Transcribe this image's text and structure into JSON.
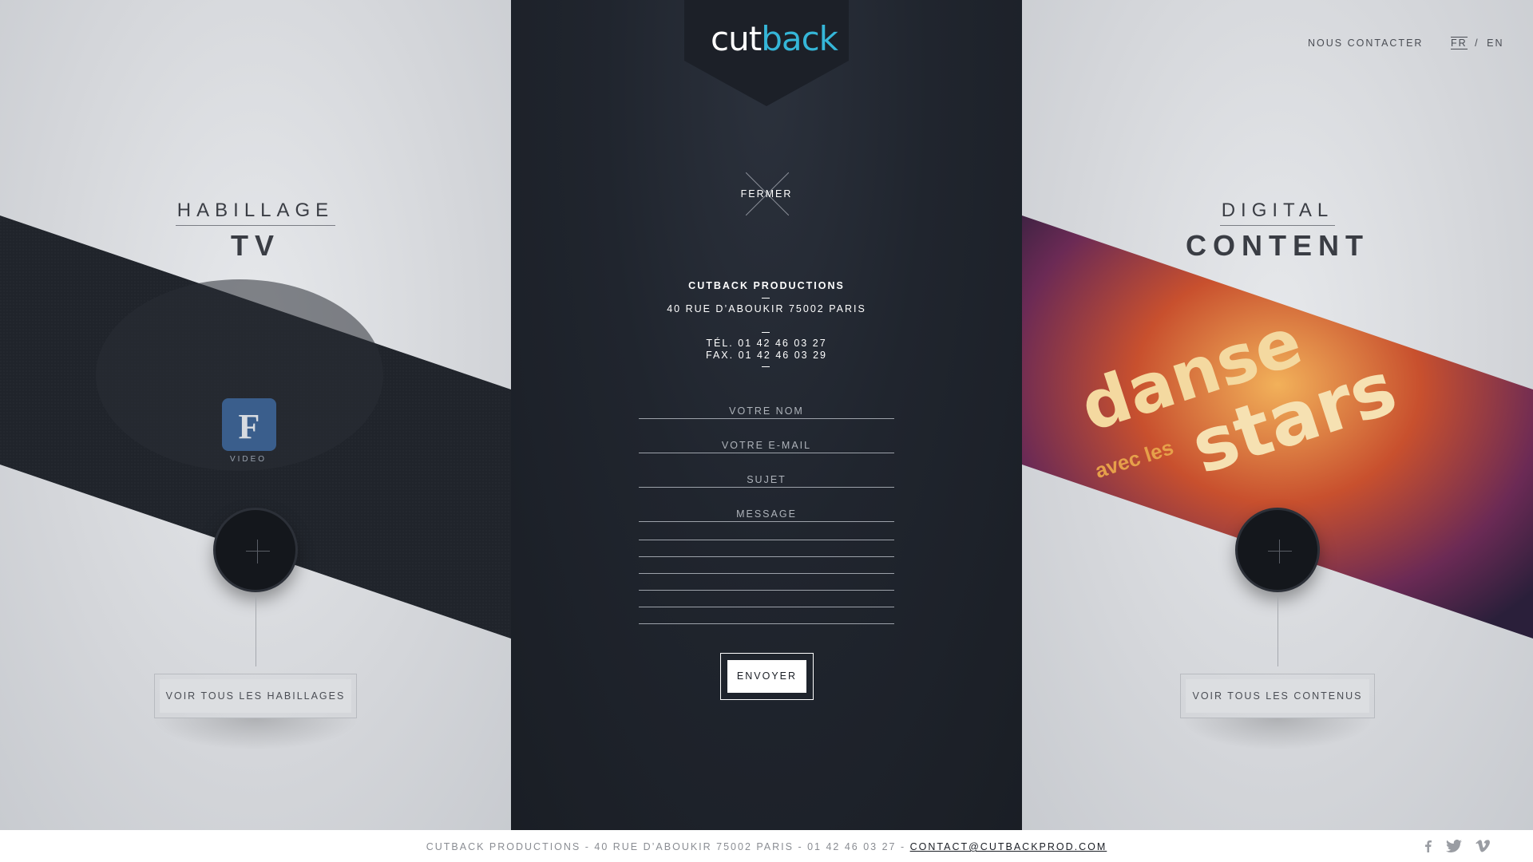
{
  "brand": {
    "logo_part1": "cut",
    "logo_part2": "back",
    "accent": "#35b6d8",
    "dark": "#1a1e25"
  },
  "nav": {
    "contact": "NOUS CONTACTER",
    "lang_fr": "FR",
    "lang_sep": "/",
    "lang_en": "EN"
  },
  "left": {
    "title_top": "HABILLAGE",
    "title_bottom": "TV",
    "badge_text": "VIDEO",
    "cta": "VOIR TOUS LES HABILLAGES"
  },
  "right": {
    "title_top": "DIGITAL",
    "title_bottom": "CONTENT",
    "image_text_1": "danse",
    "image_text_2": "avec les",
    "image_text_3": "stars",
    "cta": "VOIR TOUS LES CONTENUS"
  },
  "modal": {
    "close_label": "FERMER",
    "company": "CUTBACK PRODUCTIONS",
    "address": "40 RUE D’ABOUKIR 75002 PARIS",
    "tel": "TÉL. 01 42 46 03 27",
    "fax": "FAX. 01 42 46 03 29",
    "form": {
      "name": "VOTRE NOM",
      "email": "VOTRE E-MAIL",
      "subject": "SUJET",
      "message": "MESSAGE",
      "submit": "ENVOYER"
    }
  },
  "footer": {
    "text": "CUTBACK PRODUCTIONS - 40 RUE D’ABOUKIR 75002 PARIS - 01 42 46 03 27 -",
    "email": "CONTACT@CUTBACKPROD.COM"
  },
  "social": [
    "facebook-icon",
    "twitter-icon",
    "vimeo-icon"
  ]
}
